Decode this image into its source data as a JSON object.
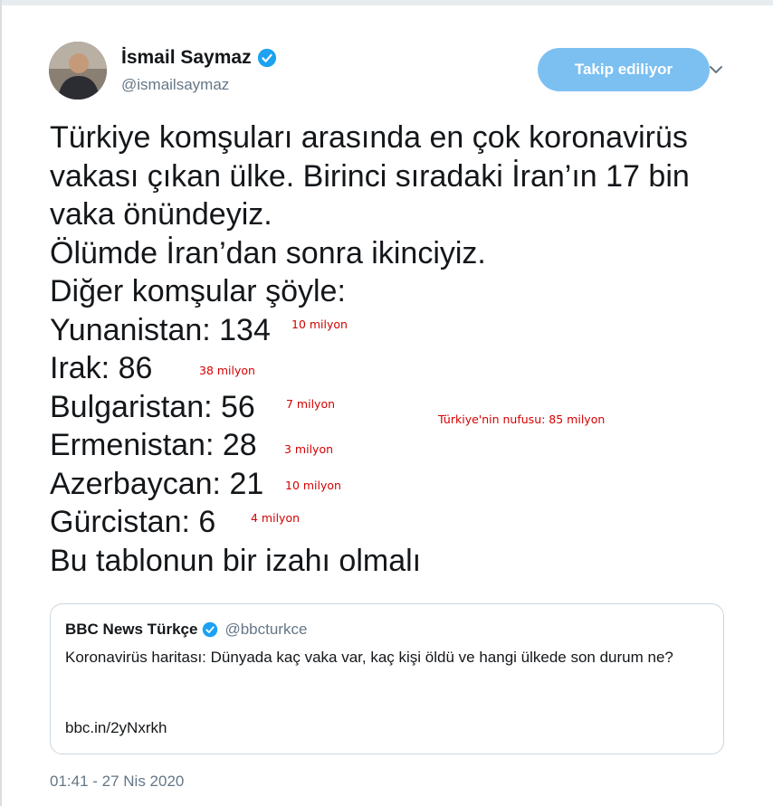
{
  "author": {
    "name": "İsmail Saymaz",
    "handle": "@ismailsaymaz"
  },
  "follow_button_label": "Takip ediliyor",
  "tweet_lines": [
    "Türkiye komşuları arasında en çok koronavirüs",
    "vakası çıkan ülke. Birinci sıradaki İran’ın 17 bin",
    "vaka önündeyiz.",
    "Ölümde İran’dan sonra ikinciyiz.",
    "Diğer komşular şöyle:",
    "Yunanistan: 134",
    "Irak: 86",
    "Bulgaristan: 56",
    "Ermenistan: 28",
    "Azerbaycan: 21",
    "Gürcistan: 6",
    "Bu tablonun bir izahı olmalı"
  ],
  "annotations": {
    "greece": "10 milyon",
    "iraq": "38 milyon",
    "bulgaria": "7 milyon",
    "armenia": "3 milyon",
    "azerbaijan": "10 milyon",
    "georgia": "4 milyon",
    "turkey": "Türkiye'nin nufusu: 85 milyon"
  },
  "quote": {
    "name": "BBC News Türkçe",
    "handle": "@bbcturkce",
    "text": "Koronavirüs haritası: Dünyada kaç vaka var, kaç kişi öldü ve hangi ülkede son durum ne?",
    "link": "bbc.in/2yNxrkh"
  },
  "timestamp": "01:41 - 27 Nis 2020",
  "colors": {
    "follow_button": "#7cc0f2",
    "verified": "#1da1f2",
    "annotation": "#d40000",
    "secondary_text": "#657786"
  }
}
